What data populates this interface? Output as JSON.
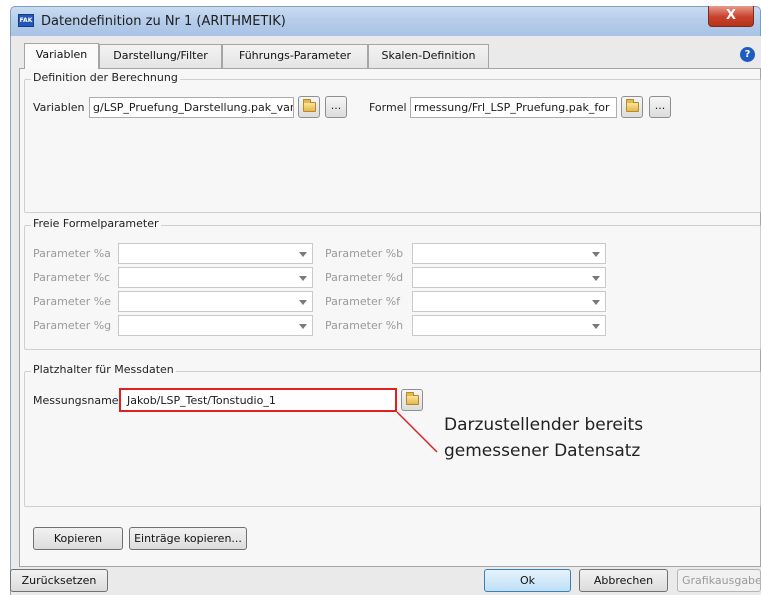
{
  "window": {
    "title": "Datendefinition zu Nr 1 (ARITHMETIK)",
    "icon_text": "FAK",
    "close_symbol": "X",
    "help_symbol": "?"
  },
  "tabs": [
    {
      "label": "Variablen",
      "active": true
    },
    {
      "label": "Darstellung/Filter",
      "active": false
    },
    {
      "label": "Führungs-Parameter",
      "active": false
    },
    {
      "label": "Skalen-Definition",
      "active": false
    }
  ],
  "calc_group": {
    "title": "Definition der Berechnung",
    "variablen_label": "Variablen",
    "variablen_value": "g/LSP_Pruefung_Darstellung.pak_var",
    "formel_label": "Formel",
    "formel_value": "rmessung/Frl_LSP_Pruefung.pak_for",
    "more_symbol": "..."
  },
  "params_group": {
    "title": "Freie Formelparameter",
    "params": [
      {
        "label": "Parameter %a",
        "value": ""
      },
      {
        "label": "Parameter %b",
        "value": ""
      },
      {
        "label": "Parameter %c",
        "value": ""
      },
      {
        "label": "Parameter %d",
        "value": ""
      },
      {
        "label": "Parameter %e",
        "value": ""
      },
      {
        "label": "Parameter %f",
        "value": ""
      },
      {
        "label": "Parameter %g",
        "value": ""
      },
      {
        "label": "Parameter %h",
        "value": ""
      }
    ]
  },
  "placeholder_group": {
    "title": "Platzhalter für Messdaten",
    "messungsname_label": "Messungsname",
    "messungsname_value": "Jakob/LSP_Test/Tonstudio_1"
  },
  "annotation": {
    "line1": "Darzustellender bereits",
    "line2": "gemessener Datensatz",
    "color": "#e02020"
  },
  "buttons": {
    "kopieren": "Kopieren",
    "eintraege_kopieren": "Einträge kopieren...",
    "zuruecksetzen": "Zurücksetzen",
    "ok": "Ok",
    "abbrechen": "Abbrechen",
    "grafikausgabe": "Grafikausgabe"
  }
}
